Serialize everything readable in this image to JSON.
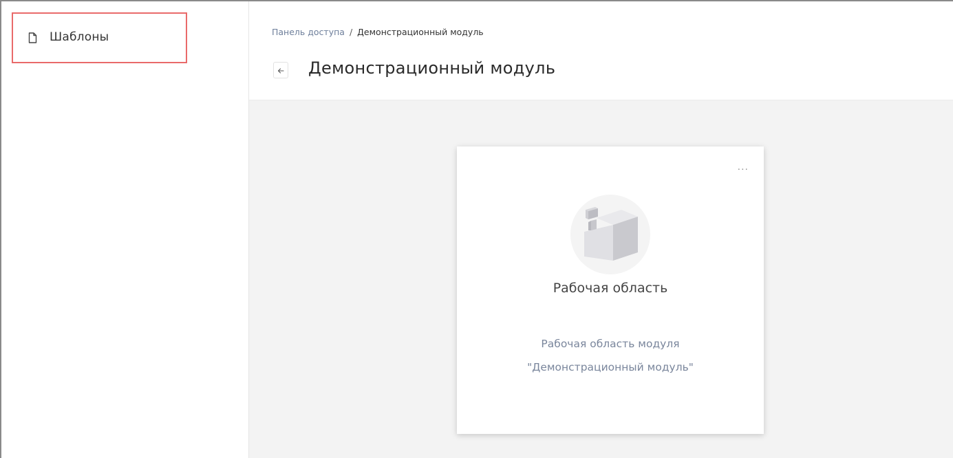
{
  "sidebar": {
    "items": [
      {
        "label": "Шаблоны",
        "icon": "document-icon"
      }
    ]
  },
  "header": {
    "breadcrumb": {
      "root": "Панель доступа",
      "separator": "/",
      "current": "Демонстрационный модуль"
    },
    "back_icon": "arrow-left-icon",
    "title": "Демонстрационный модуль"
  },
  "workspace_card": {
    "menu_label": "···",
    "icon": "cube-icon",
    "title": "Рабочая область",
    "description_line1": "Рабочая область модуля",
    "description_line2": "\"Демонстрационный модуль\""
  },
  "colors": {
    "highlight_border": "#e96a6a",
    "main_background": "#f3f3f3",
    "breadcrumb_link": "#6e7f9b",
    "description_text": "#7a869c"
  }
}
